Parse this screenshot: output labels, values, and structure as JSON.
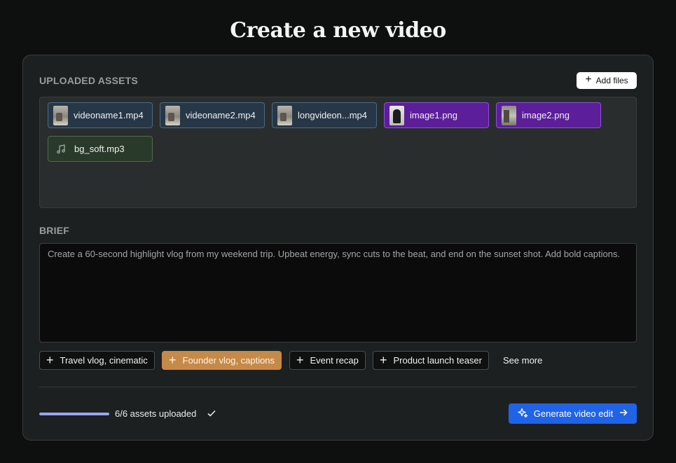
{
  "page": {
    "title": "Create a new video"
  },
  "uploaded_assets": {
    "label": "UPLOADED ASSETS",
    "add_files_label": "Add files",
    "items": [
      {
        "name": "videoname1.mp4",
        "kind": "video"
      },
      {
        "name": "videoname2.mp4",
        "kind": "video"
      },
      {
        "name": "longvideon...mp4",
        "kind": "video"
      },
      {
        "name": "image1.png",
        "kind": "image"
      },
      {
        "name": "image2.png",
        "kind": "image"
      },
      {
        "name": "bg_soft.mp3",
        "kind": "audio"
      }
    ]
  },
  "brief": {
    "label": "BRIEF",
    "text": "Create a 60-second highlight vlog from my weekend trip. Upbeat energy, sync cuts to the beat, and end on the sunset shot. Add bold captions."
  },
  "suggestions": {
    "items": [
      {
        "label": "Travel vlog, cinematic",
        "selected": false
      },
      {
        "label": "Founder vlog, captions",
        "selected": true
      },
      {
        "label": "Event recap",
        "selected": false
      },
      {
        "label": "Product launch teaser",
        "selected": false
      }
    ],
    "see_more_label": "See more"
  },
  "footer": {
    "progress_fraction": 1.0,
    "progress_text": "6/6 assets uploaded",
    "generate_label": "Generate video edit"
  },
  "colors": {
    "accent": "#2163e6",
    "selected_suggestion": "#c68a48",
    "image_chip": "#5c1e9a",
    "video_chip": "#273747",
    "audio_chip": "#2a3a2a",
    "progress": "#9aa4f3"
  },
  "icons": [
    "plus-icon",
    "music-note-icon",
    "check-icon",
    "sparkle-icon",
    "arrow-right-icon"
  ]
}
